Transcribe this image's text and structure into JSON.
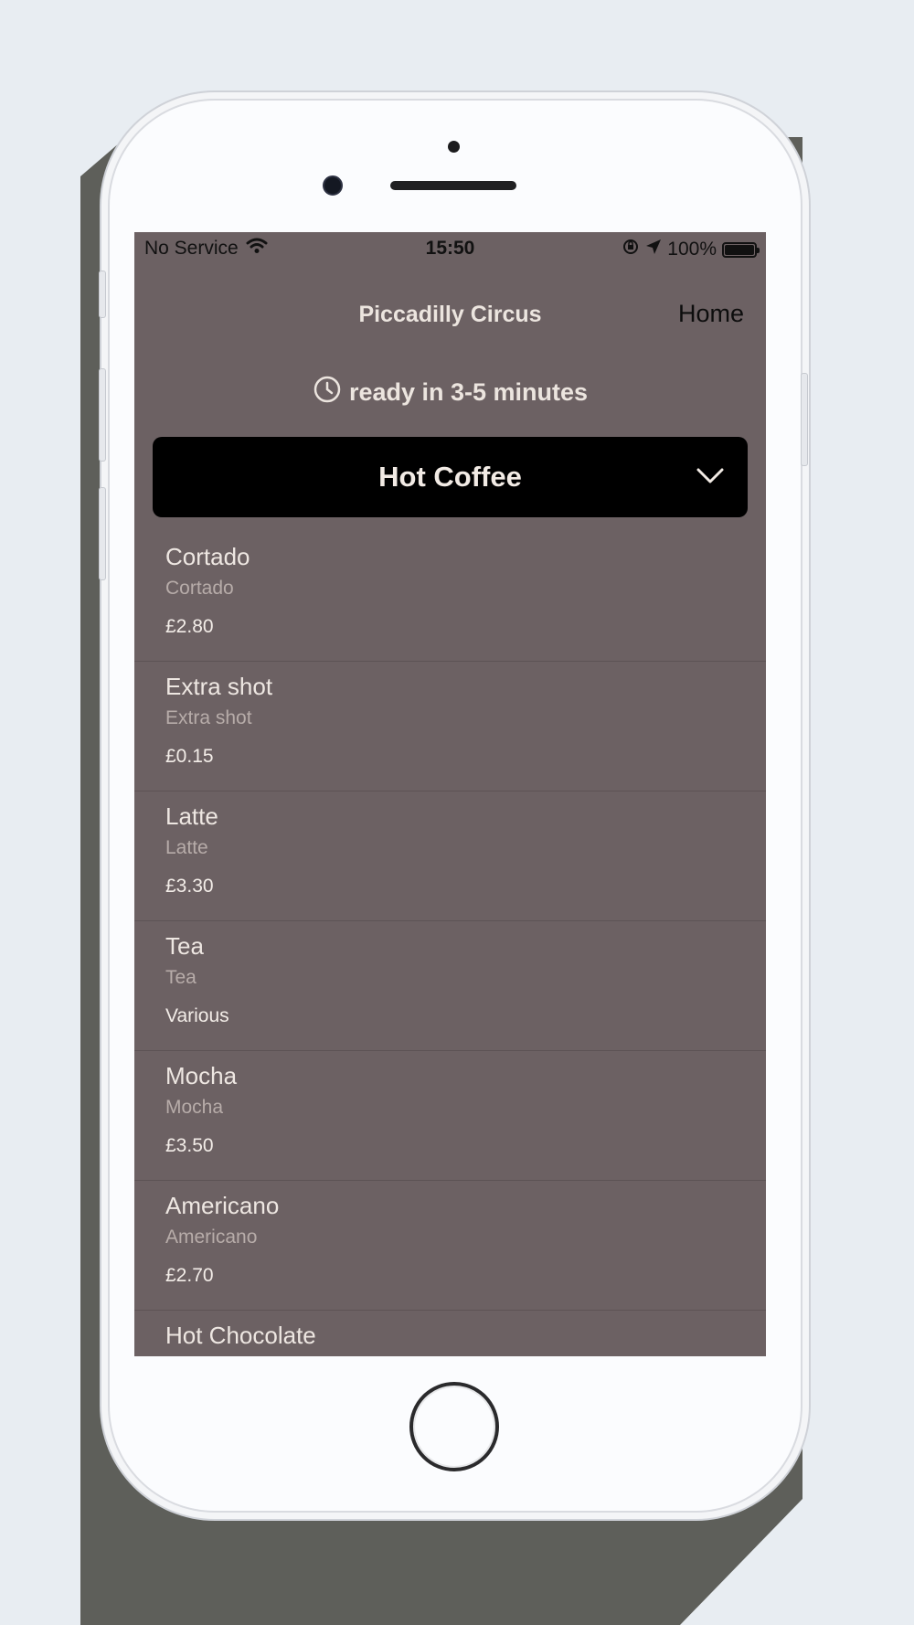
{
  "status_bar": {
    "carrier": "No Service",
    "time": "15:50",
    "battery_percent": "100%",
    "battery_level": 1.0
  },
  "nav": {
    "title": "Piccadilly Circus",
    "home_label": "Home"
  },
  "ready": {
    "text": "ready in 3-5 minutes"
  },
  "category": {
    "selected": "Hot Coffee"
  },
  "menu_items": [
    {
      "name": "Cortado",
      "description": "Cortado",
      "price": "£2.80"
    },
    {
      "name": "Extra shot",
      "description": "Extra shot",
      "price": "£0.15"
    },
    {
      "name": "Latte",
      "description": "Latte",
      "price": "£3.30"
    },
    {
      "name": "Tea",
      "description": "Tea",
      "price": "Various"
    },
    {
      "name": "Mocha",
      "description": "Mocha",
      "price": "£3.50"
    },
    {
      "name": "Americano",
      "description": "Americano",
      "price": "£2.70"
    },
    {
      "name": "Hot Chocolate",
      "description": "",
      "price": ""
    }
  ],
  "colors": {
    "screen_background": "#6c6163",
    "dropdown_background": "#000000",
    "page_background": "#e8edf2",
    "shadow": "#5e5f5a"
  }
}
